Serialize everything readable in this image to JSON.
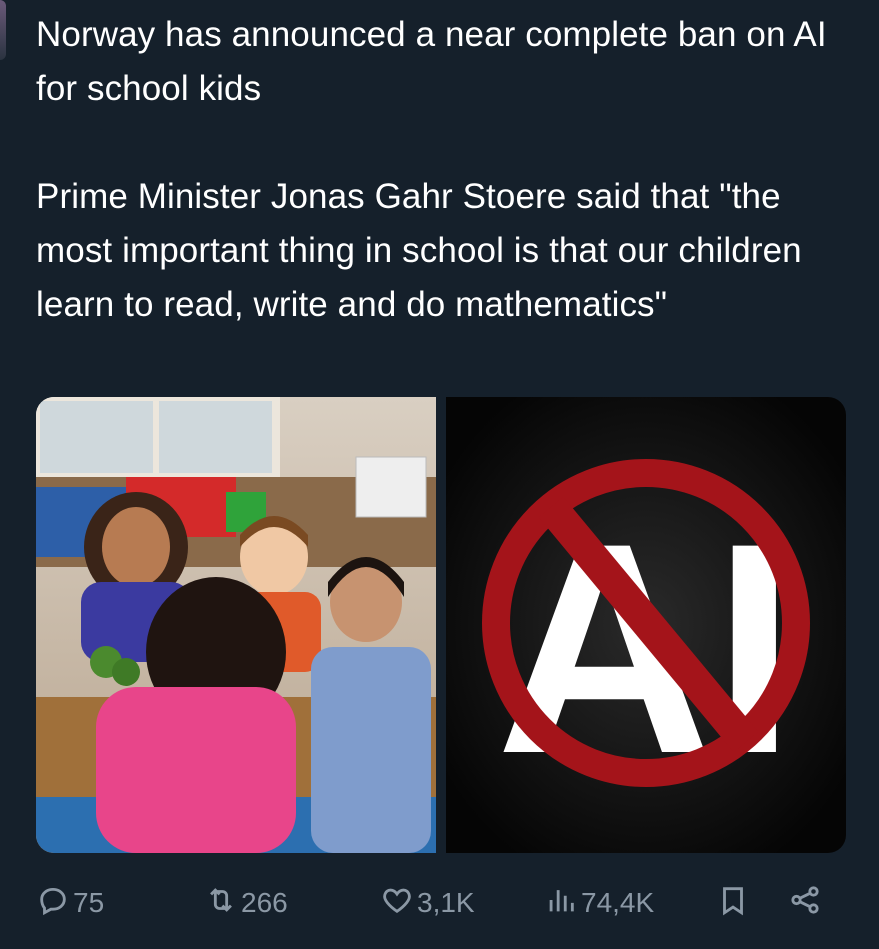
{
  "tweet": {
    "headline": "Norway has announced a near complete ban on AI for school kids",
    "body": "Prime Minister Jonas Gahr Stoere said that \"the most important thing in school is that our children learn to read, write and do mathematics\""
  },
  "media": [
    {
      "kind": "photo",
      "depiction": "children at classroom table"
    },
    {
      "kind": "graphic",
      "logo_text": "AI"
    }
  ],
  "actions": {
    "replies": "75",
    "reposts": "266",
    "likes": "3,1K",
    "views": "74,4K"
  },
  "icons": [
    "reply-icon",
    "repost-icon",
    "like-icon",
    "views-icon",
    "bookmark-icon",
    "share-icon"
  ],
  "colors": {
    "background": "#15202b",
    "text": "#ffffff",
    "muted": "#8b98a5",
    "prohibition_red": "#a4141a"
  }
}
